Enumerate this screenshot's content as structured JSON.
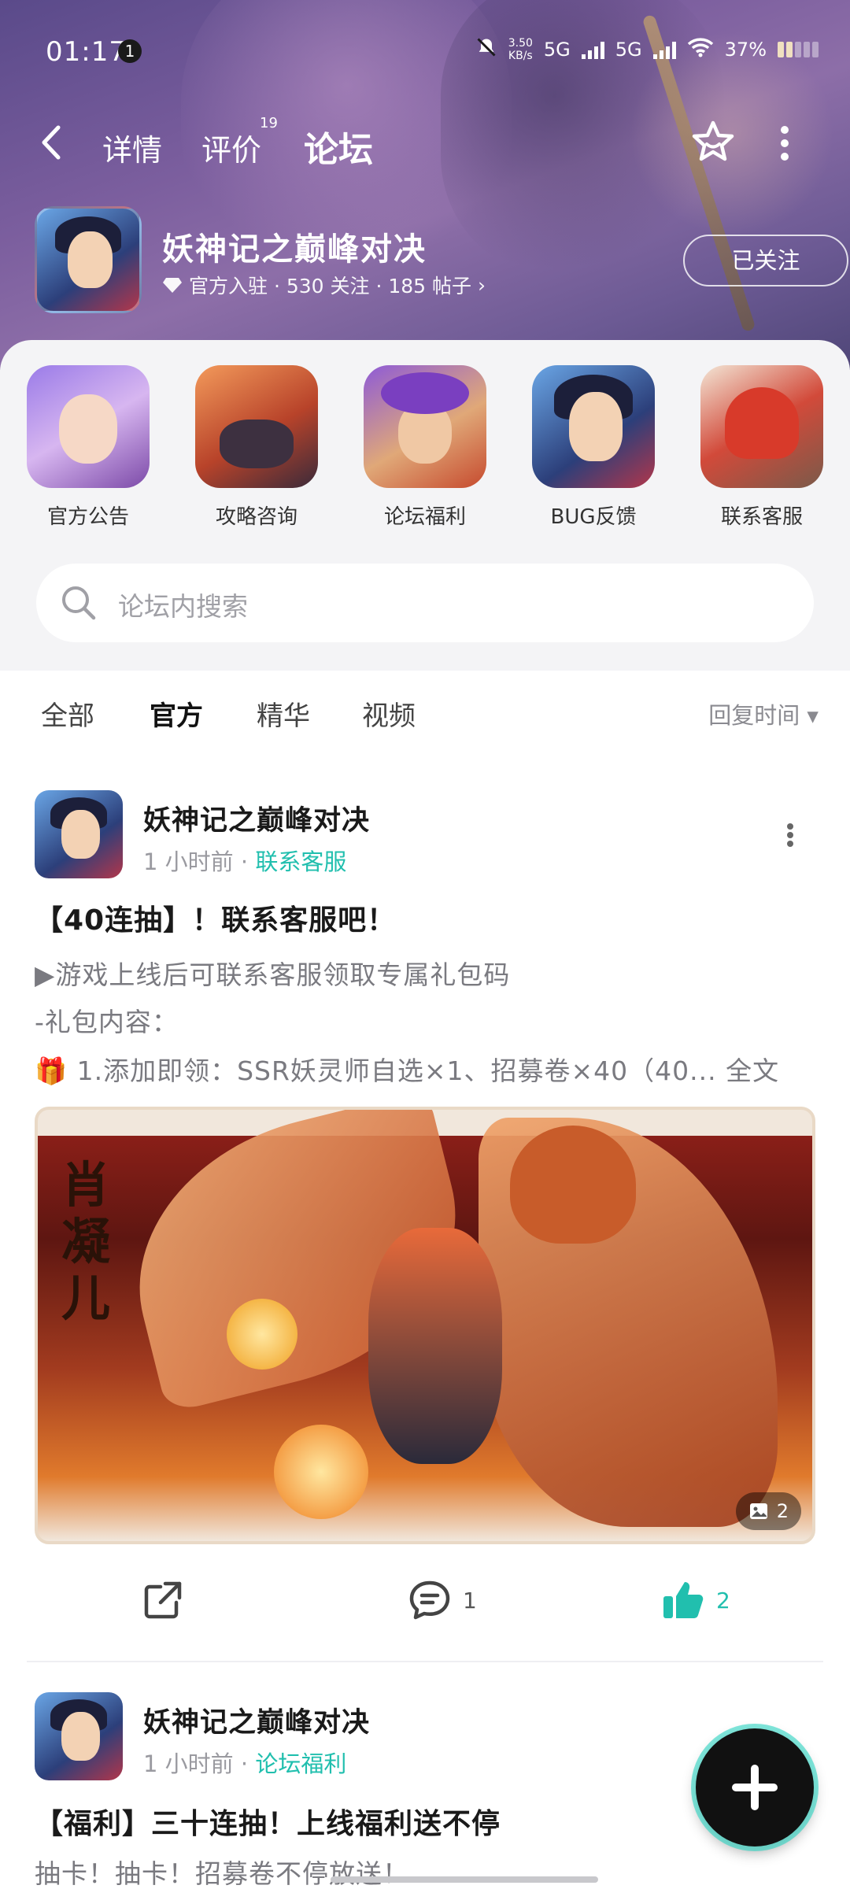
{
  "status_bar": {
    "time": "01:17",
    "notification_count": "1",
    "net_speed_top": "3.50",
    "net_speed_bottom": "KB/s",
    "sim1": "5G",
    "sim2": "5G",
    "battery": "37%"
  },
  "nav": {
    "tabs": [
      {
        "label": "详情"
      },
      {
        "label": "评价",
        "badge": "19"
      },
      {
        "label": "论坛",
        "active": true
      }
    ]
  },
  "game": {
    "name": "妖神记之巅峰对决",
    "meta": "官方入驻 · 530 关注 · 185 帖子",
    "follow_label": "已关注"
  },
  "shortcuts": [
    {
      "label": "官方公告"
    },
    {
      "label": "攻略咨询"
    },
    {
      "label": "论坛福利"
    },
    {
      "label": "BUG反馈"
    },
    {
      "label": "联系客服"
    }
  ],
  "search": {
    "placeholder": "论坛内搜索"
  },
  "filters": {
    "tabs": [
      {
        "label": "全部"
      },
      {
        "label": "官方",
        "active": true
      },
      {
        "label": "精华"
      },
      {
        "label": "视频"
      }
    ],
    "sort_label": "回复时间 ▾"
  },
  "posts": [
    {
      "author": "妖神记之巅峰对决",
      "time": "1 小时前 · ",
      "category": "联系客服",
      "title": "【40连抽】！联系客服吧！",
      "lines": [
        "▶游戏上线后可联系客服领取专属礼包码",
        "-礼包内容：",
        "🎁 1.添加即领：SSR妖灵师自选×1、招募卷×40（40... 全文"
      ],
      "banner_side_text": "肖凝儿",
      "image_count": "2",
      "comments": "1",
      "likes": "2"
    },
    {
      "author": "妖神记之巅峰对决",
      "time": "1 小时前 · ",
      "category": "论坛福利",
      "title": "【福利】三十连抽！上线福利送不停",
      "lines": [
        "抽卡！抽卡！招募卷不停放送！"
      ]
    }
  ],
  "colors": {
    "accent": "#21bfae",
    "underline": "#29d3c2",
    "hero_purple": "#7b5e9e"
  }
}
